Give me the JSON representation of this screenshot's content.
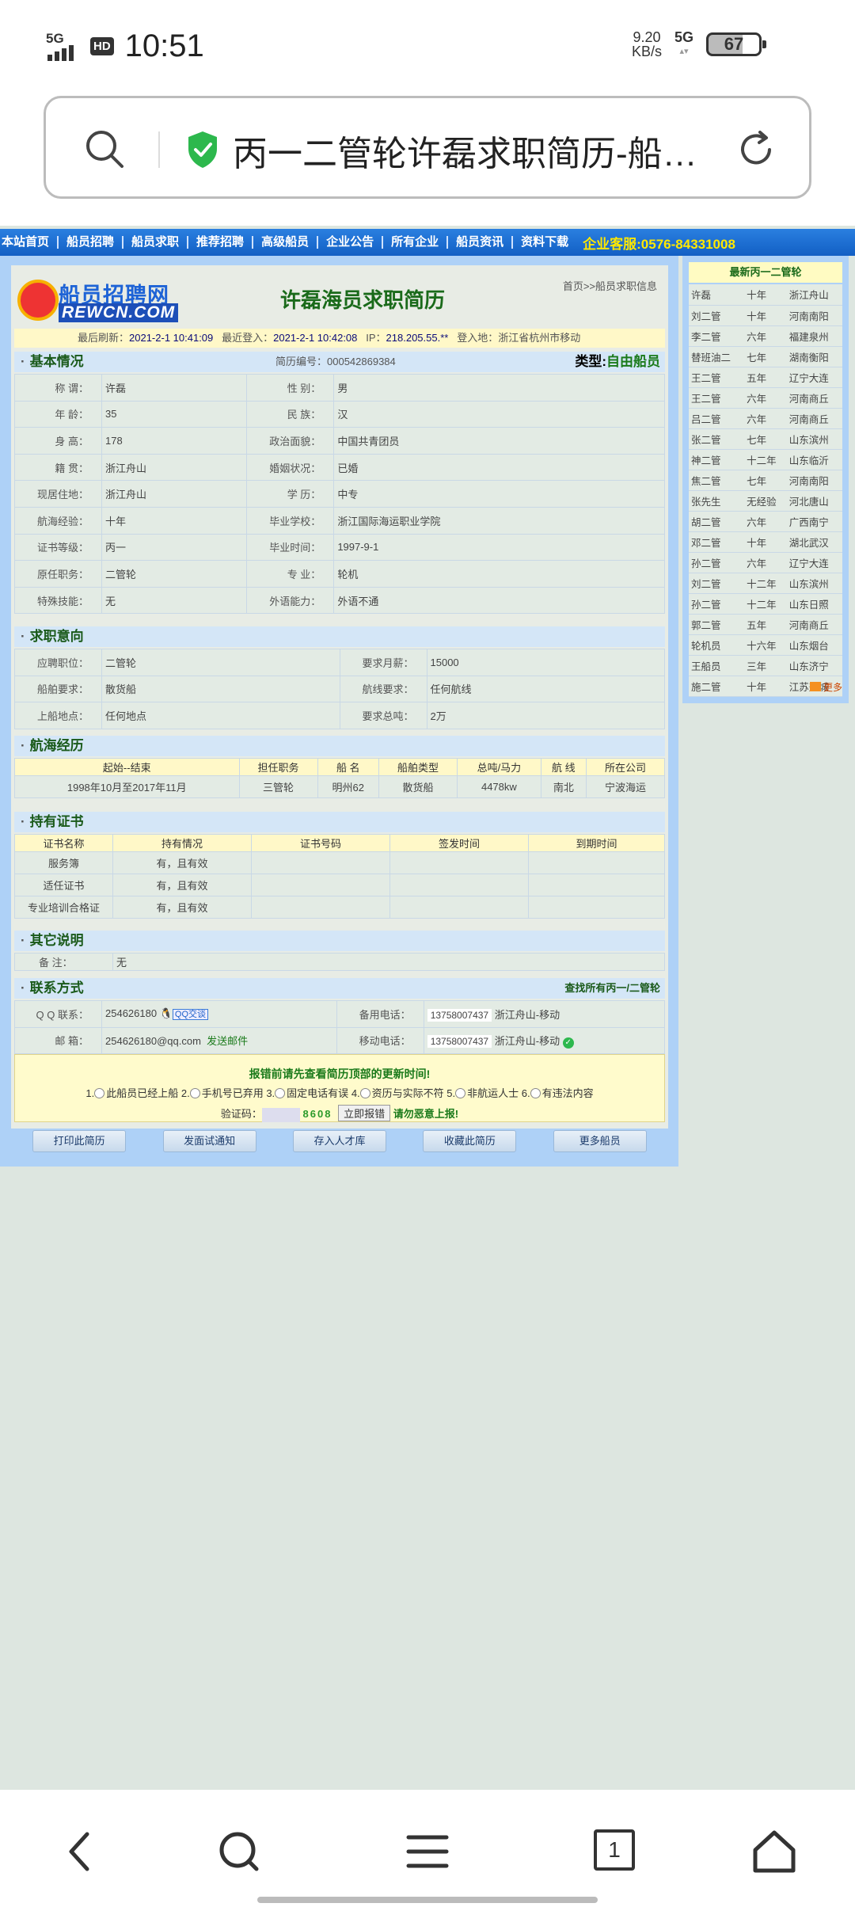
{
  "statusbar": {
    "network_label": "5G",
    "hd_label": "HD",
    "time": "10:51",
    "speed_value": "9.20",
    "speed_unit": "KB/s",
    "network2_label": "5G",
    "battery": "67"
  },
  "browser": {
    "page_title": "丙一二管轮许磊求职简历-船…",
    "icons": [
      "search-icon",
      "shield-icon",
      "refresh-icon"
    ]
  },
  "site": {
    "nav": [
      {
        "label": "本站首页"
      },
      {
        "label": "船员招聘"
      },
      {
        "label": "船员求职"
      },
      {
        "label": "推荐招聘"
      },
      {
        "label": "高级船员"
      },
      {
        "label": "企业公告"
      },
      {
        "label": "所有企业"
      },
      {
        "label": "船员资讯"
      },
      {
        "label": "资料下载"
      }
    ],
    "hotline": "企业客服:0576-84331008",
    "logo_cn": "船员招聘网",
    "logo_en": "REWCN.COM",
    "page_heading": "许磊海员求职简历",
    "breadcrumb": "首页>>船员求职信息"
  },
  "refresh": {
    "last_refresh_label": "最后刷新：",
    "last_refresh": "2021-2-1 10:41:09",
    "last_login_label": "最近登入：",
    "last_login": "2021-2-1 10:42:08",
    "ip_label": "IP：",
    "ip": "218.205.55.**",
    "location_label": "登入地：",
    "location": "浙江省杭州市移动"
  },
  "basic": {
    "title": "基本情况",
    "resume_no": "简历编号：000542869384",
    "type_label": "类型:",
    "type_value": "自由船员",
    "rows": [
      {
        "k1": "称    谓：",
        "v1": "许磊",
        "k2": "性    别：",
        "v2": "男"
      },
      {
        "k1": "年    龄：",
        "v1": "35",
        "k2": "民    族：",
        "v2": "汉"
      },
      {
        "k1": "身    高：",
        "v1": "178",
        "k2": "政治面貌：",
        "v2": "中国共青团员"
      },
      {
        "k1": "籍    贯：",
        "v1": "浙江舟山",
        "k2": "婚姻状况：",
        "v2": "已婚"
      },
      {
        "k1": "现居住地：",
        "v1": "浙江舟山",
        "k2": "学    历：",
        "v2": "中专"
      },
      {
        "k1": "航海经验：",
        "v1": "十年",
        "k2": "毕业学校：",
        "v2": "浙江国际海运职业学院"
      },
      {
        "k1": "证书等级：",
        "v1": "丙一",
        "k2": "毕业时间：",
        "v2": "1997-9-1"
      },
      {
        "k1": "原任职务：",
        "v1": "二管轮",
        "k2": "专    业：",
        "v2": "轮机"
      },
      {
        "k1": "特殊技能：",
        "v1": "无",
        "k2": "外语能力：",
        "v2": "外语不通"
      }
    ]
  },
  "intent": {
    "title": "求职意向",
    "rows": [
      {
        "k1": "应聘职位：",
        "v1": "二管轮",
        "k2": "要求月薪：",
        "v2": "15000"
      },
      {
        "k1": "船舶要求：",
        "v1": "散货船",
        "k2": "航线要求：",
        "v2": "任何航线"
      },
      {
        "k1": "上船地点：",
        "v1": "任何地点",
        "k2": "要求总吨：",
        "v2": "2万"
      }
    ]
  },
  "experience": {
    "title": "航海经历",
    "headers": [
      "起始--结束",
      "担任职务",
      "船  名",
      "船舶类型",
      "总吨/马力",
      "航  线",
      "所在公司"
    ],
    "rows": [
      [
        "1998年10月至2017年11月",
        "三管轮",
        "明州62",
        "散货船",
        "4478kw",
        "南北",
        "宁波海运"
      ]
    ]
  },
  "certs": {
    "title": "持有证书",
    "headers": [
      "证书名称",
      "持有情况",
      "证书号码",
      "签发时间",
      "到期时间"
    ],
    "rows": [
      [
        "服务簿",
        "有，且有效",
        "",
        "",
        ""
      ],
      [
        "适任证书",
        "有，且有效",
        "",
        "",
        ""
      ],
      [
        "专业培训合格证",
        "有，且有效",
        "",
        "",
        ""
      ]
    ]
  },
  "other": {
    "title": "其它说明",
    "label": "备    注：",
    "value": "无"
  },
  "contact": {
    "title": "联系方式",
    "right_link": "查找所有丙一/二管轮",
    "qq_label": "Q Q 联系：",
    "qq": "254626180",
    "qq_chat": "QQ交谈",
    "backup_label": "备用电话：",
    "backup_phone": "13758007437",
    "backup_loc": "浙江舟山-移动",
    "email_label": "邮    箱：",
    "email": "254626180@qq.com",
    "send_mail": "发送邮件",
    "mobile_label": "移动电话：",
    "mobile_phone": "13758007437",
    "mobile_loc": "浙江舟山-移动"
  },
  "report": {
    "notice": "报错前请先查看简历顶部的更新时间!",
    "options": [
      "1.",
      "此船员已经上船",
      "2.",
      "手机号已弃用",
      "3.",
      "固定电话有误",
      "4.",
      "资历与实际不符",
      "5.",
      "非航运人士",
      "6.",
      "有违法内容"
    ],
    "captcha_label": "验证码：",
    "captcha_code": "8608",
    "submit": "立即报错",
    "warning": "请勿恶意上报!"
  },
  "actions": [
    "打印此简历",
    "发面试通知",
    "存入人才库",
    "收藏此简历",
    "更多船员"
  ],
  "sidebar": {
    "title": "最新丙一二管轮",
    "rows": [
      [
        "许磊",
        "十年",
        "浙江舟山"
      ],
      [
        "刘二管",
        "十年",
        "河南南阳"
      ],
      [
        "李二管",
        "六年",
        "福建泉州"
      ],
      [
        "替班油二",
        "七年",
        "湖南衡阳"
      ],
      [
        "王二管",
        "五年",
        "辽宁大连"
      ],
      [
        "王二管",
        "六年",
        "河南商丘"
      ],
      [
        "吕二管",
        "六年",
        "河南商丘"
      ],
      [
        "张二管",
        "七年",
        "山东滨州"
      ],
      [
        "神二管",
        "十二年",
        "山东临沂"
      ],
      [
        "焦二管",
        "七年",
        "河南南阳"
      ],
      [
        "张先生",
        "无经验",
        "河北唐山"
      ],
      [
        "胡二管",
        "六年",
        "广西南宁"
      ],
      [
        "邓二管",
        "十年",
        "湖北武汉"
      ],
      [
        "孙二管",
        "六年",
        "辽宁大连"
      ],
      [
        "刘二管",
        "十二年",
        "山东滨州"
      ],
      [
        "孙二管",
        "十二年",
        "山东日照"
      ],
      [
        "郭二管",
        "五年",
        "河南商丘"
      ],
      [
        "轮机员",
        "十六年",
        "山东烟台"
      ],
      [
        "王船员",
        "三年",
        "山东济宁"
      ],
      [
        "施二管",
        "十年",
        "江苏盐城"
      ]
    ],
    "more": "更多"
  },
  "bottomnav": {
    "tab_count": "1",
    "icons": [
      "back-icon",
      "search-icon",
      "menu-icon",
      "tabs-icon",
      "home-icon"
    ]
  }
}
